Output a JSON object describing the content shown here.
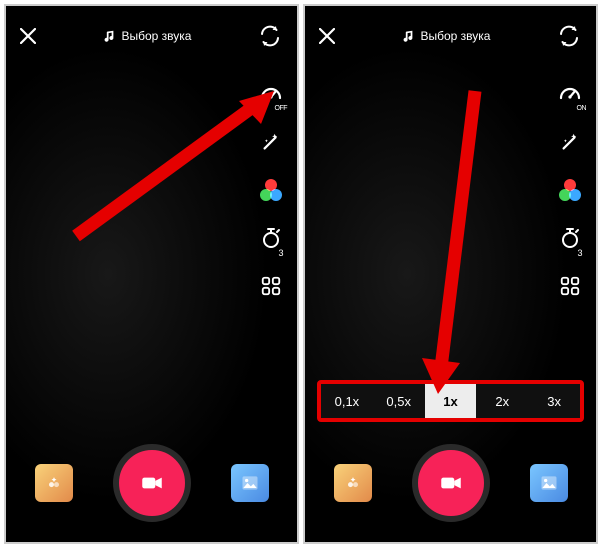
{
  "topbar": {
    "sound_label": "Выбор звука"
  },
  "tools": {
    "speed_sub_left": "OFF",
    "speed_sub_right": "ON",
    "timer_sub": "3"
  },
  "speeds": [
    "0,1x",
    "0,5x",
    "1x",
    "2x",
    "3x"
  ],
  "speed_selected_index": 2
}
